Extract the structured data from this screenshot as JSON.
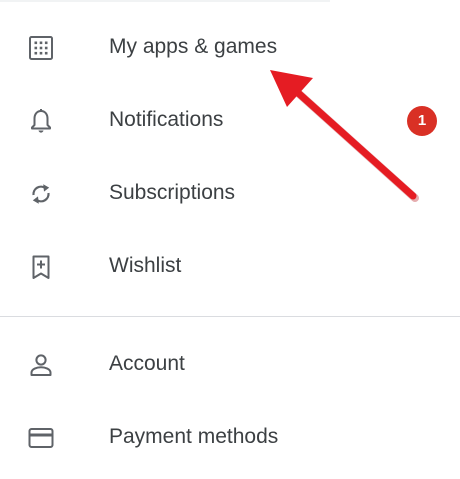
{
  "menu": {
    "items": [
      {
        "label": "My apps & games",
        "icon": "apps-grid-icon"
      },
      {
        "label": "Notifications",
        "icon": "bell-icon",
        "badge": "1"
      },
      {
        "label": "Subscriptions",
        "icon": "refresh-icon"
      },
      {
        "label": "Wishlist",
        "icon": "bookmark-add-icon"
      }
    ],
    "account_items": [
      {
        "label": "Account",
        "icon": "person-icon"
      },
      {
        "label": "Payment methods",
        "icon": "credit-card-icon"
      }
    ]
  },
  "annotation": {
    "type": "arrow",
    "color": "#e51c23",
    "points_to": "My apps & games"
  },
  "colors": {
    "text": "#3c4043",
    "icon": "#5f6368",
    "badge": "#d93025",
    "divider": "#dadce0"
  }
}
